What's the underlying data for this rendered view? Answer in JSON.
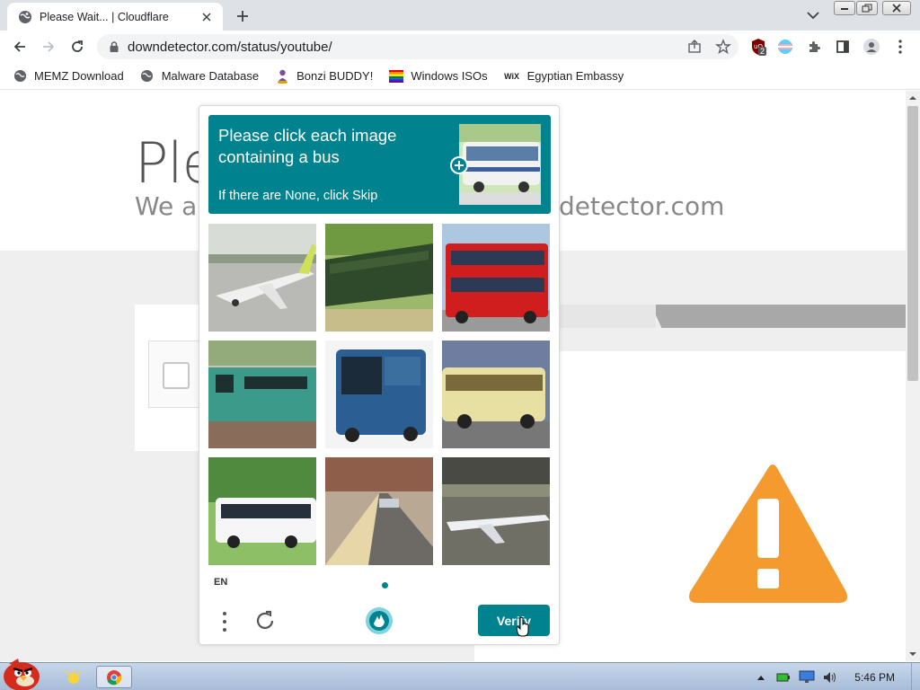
{
  "browser": {
    "tab_title": "Please Wait... | Cloudflare",
    "url": "downdetector.com/status/youtube/",
    "extension_badge": "2",
    "bookmarks": [
      {
        "label": "MEMZ Download",
        "icon": "globe-icon"
      },
      {
        "label": "Malware Database",
        "icon": "globe-icon"
      },
      {
        "label": "Bonzi BUDDY!",
        "icon": "bonzi-icon"
      },
      {
        "label": "Windows ISOs",
        "icon": "rainbow-flag-icon"
      },
      {
        "label": "Egyptian Embassy",
        "icon": "wix-icon",
        "icon_text": "WiX"
      }
    ]
  },
  "page": {
    "title_partial": "Ple",
    "subtitle_partial_left": "We ar",
    "subtitle_partial_right": "detector.com"
  },
  "captcha": {
    "prompt_line": "Please click each image containing a bus",
    "hint": "If there are None, click Skip",
    "language": "EN",
    "verify_label": "Verify",
    "tiles": [
      {
        "name": "tile-airplane-1",
        "selected": false
      },
      {
        "name": "tile-train-green-1",
        "selected": false
      },
      {
        "name": "tile-bus-red-double-decker",
        "selected": false
      },
      {
        "name": "tile-train-green-2",
        "selected": false
      },
      {
        "name": "tile-bus-blue",
        "selected": false
      },
      {
        "name": "tile-bus-yellow",
        "selected": false
      },
      {
        "name": "tile-bus-white",
        "selected": false
      },
      {
        "name": "tile-train-station",
        "selected": false
      },
      {
        "name": "tile-airplane-2",
        "selected": false
      }
    ],
    "accent_color": "#00838f"
  },
  "taskbar": {
    "clock": "5:46 PM"
  }
}
